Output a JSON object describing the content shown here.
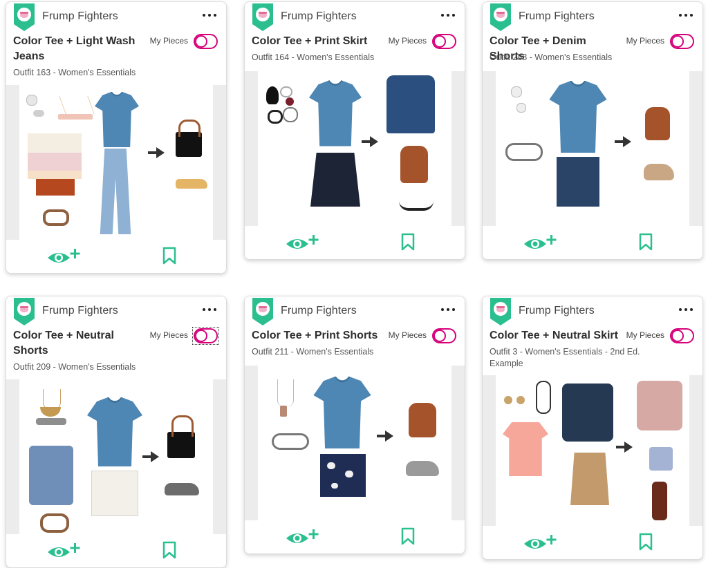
{
  "colors": {
    "accent": "#2bbf8f",
    "toggle": "#d6007a",
    "brand_badge": "#2bbf8f"
  },
  "cards": [
    {
      "brand": "Frump Fighters",
      "title": "Color Tee + Light Wash Jeans",
      "subtitle": "Outfit 163 - Women's Essentials",
      "my_pieces": "My Pieces"
    },
    {
      "brand": "Frump Fighters",
      "title": "Color Tee + Print Skirt",
      "subtitle": "Outfit 164 - Women's Essentials",
      "my_pieces": "My Pieces"
    },
    {
      "brand": "Frump Fighters",
      "title": "Color Tee + Denim Shorts",
      "subtitle": "Outfit 208 - Women's Essentials",
      "my_pieces": "My Pieces"
    },
    {
      "brand": "Frump Fighters",
      "title": "Color Tee + Neutral Shorts",
      "subtitle": "Outfit 209 - Women's Essentials",
      "my_pieces": "My Pieces"
    },
    {
      "brand": "Frump Fighters",
      "title": "Color Tee + Print Shorts",
      "subtitle": "Outfit 211 - Women's Essentials",
      "my_pieces": "My Pieces"
    },
    {
      "brand": "Frump Fighters",
      "title": "Color Tee + Neutral Skirt",
      "subtitle": "Outfit 3 - Women's Essentials - 2nd Ed. Example",
      "my_pieces": "My Pieces"
    }
  ]
}
